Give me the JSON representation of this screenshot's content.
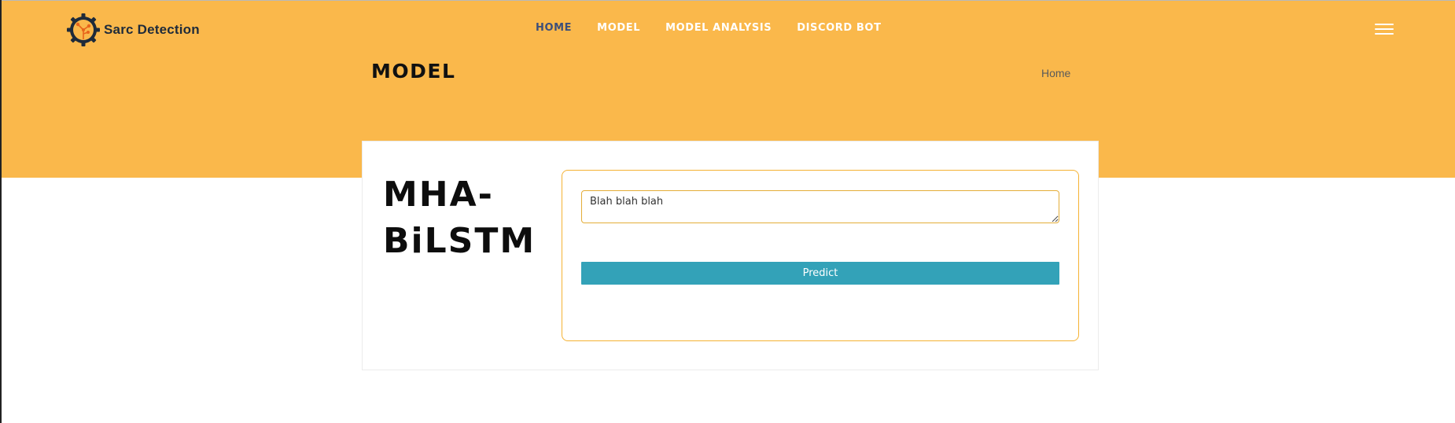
{
  "brand": {
    "name": "Sarc Detection",
    "logo_icon": "gear-node-logo-icon"
  },
  "nav": {
    "links": [
      {
        "label": "HOME",
        "active": true
      },
      {
        "label": "MODEL",
        "active": false
      },
      {
        "label": "MODEL ANALYSIS",
        "active": false
      },
      {
        "label": "DISCORD BOT",
        "active": false
      }
    ],
    "menu_icon": "hamburger-menu-icon"
  },
  "header": {
    "title": "MODEL",
    "breadcrumb": "Home"
  },
  "card": {
    "model_name": "MHA-BiLSTM",
    "input_value": "Blah blah blah",
    "predict_label": "Predict"
  },
  "colors": {
    "hero_background": "#fab84b",
    "nav_active": "#3d4f7a",
    "button_background": "#33a2b8",
    "form_border": "#f5b233"
  }
}
